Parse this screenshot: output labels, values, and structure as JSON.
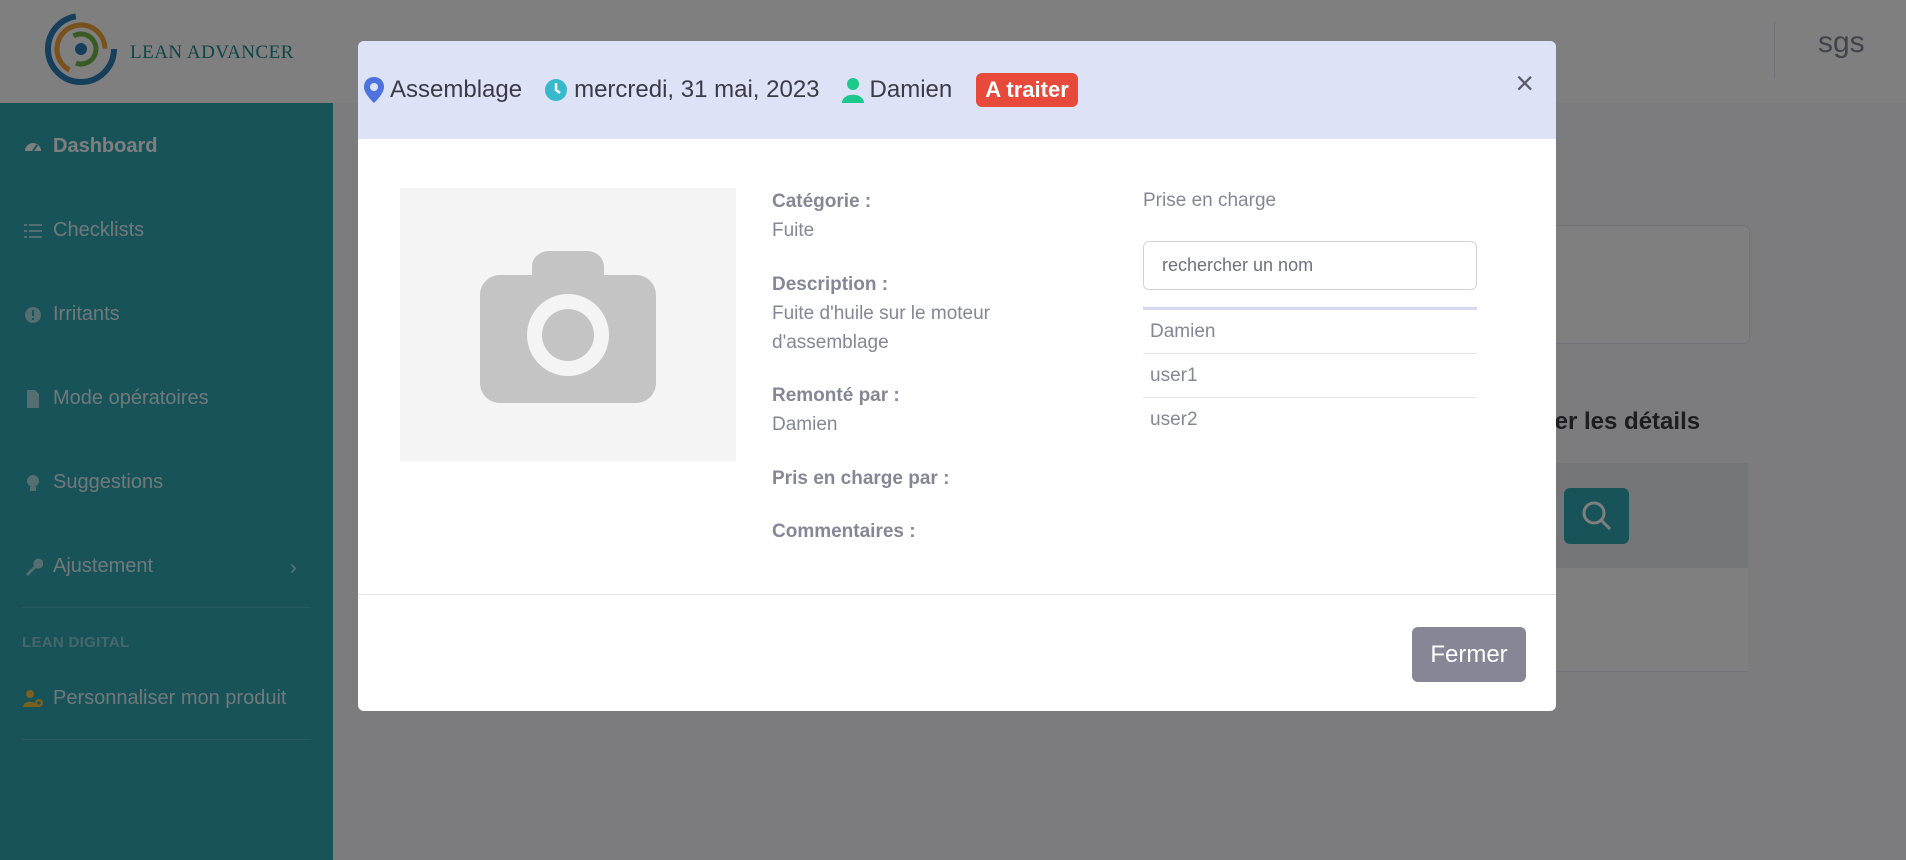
{
  "app": {
    "logo_text": "LEAN ADVANCER",
    "user": "sgs"
  },
  "sidebar": {
    "items": [
      {
        "label": "Dashboard",
        "icon": "tachometer-icon"
      },
      {
        "label": "Checklists",
        "icon": "tasks-icon"
      },
      {
        "label": "Irritants",
        "icon": "exclamation-circle-icon"
      },
      {
        "label": "Mode opératoires",
        "icon": "file-icon"
      },
      {
        "label": "Suggestions",
        "icon": "lightbulb-icon"
      },
      {
        "label": "Ajustement",
        "icon": "wrench-icon"
      }
    ],
    "heading": "LEAN DIGITAL",
    "product_item": {
      "label": "Personnaliser mon produit",
      "icon": "user-cog-icon"
    }
  },
  "background": {
    "details_title": "ner les détails"
  },
  "modal": {
    "location": "Assemblage",
    "date": "mercredi, 31 mai, 2023",
    "reporter": "Damien",
    "status": "A traiter",
    "fields": {
      "category_label": "Catégorie :",
      "category_value": "Fuite",
      "description_label": "Description :",
      "description_value": "Fuite d'huile sur le moteur d'assemblage",
      "reported_by_label": "Remonté par :",
      "reported_by_value": "Damien",
      "taken_by_label": "Pris en charge par :",
      "comments_label": "Commentaires :"
    },
    "take_charge_label": "Prise en charge",
    "search_placeholder": "rechercher un nom",
    "users": [
      "Damien",
      "user1",
      "user2"
    ],
    "close_label": "Fermer"
  },
  "colors": {
    "sidebar": "#2ea7b2",
    "header_bg": "#dde2f6",
    "badge": "#e74a3b",
    "close_button": "#858796"
  }
}
